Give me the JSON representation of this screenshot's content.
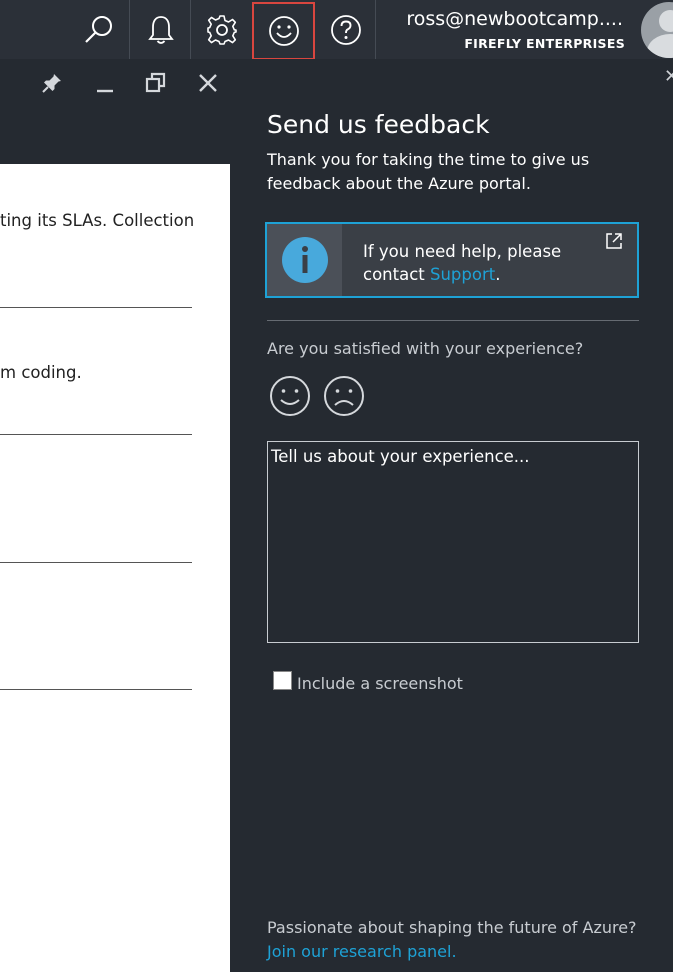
{
  "topbar": {
    "icons": [
      "search-icon",
      "bell-icon",
      "gear-icon",
      "smiley-icon",
      "help-icon"
    ],
    "active_icon": "smiley-icon",
    "user_name": "ross@newbootcamp....",
    "user_org": "FIREFLY ENTERPRISES"
  },
  "blade": {
    "controls": [
      "pin-icon",
      "minimize-icon",
      "restore-icon",
      "close-icon"
    ],
    "lines": [
      "ting its SLAs. Collection",
      "m coding."
    ]
  },
  "feedback": {
    "title": "Send us feedback",
    "subtitle": "Thank you for taking the time to give us feedback about the Azure portal.",
    "help_text": "If you need help, please contact ",
    "help_link": "Support",
    "help_period": ".",
    "question": "Are you satisfied with your experience?",
    "textarea_placeholder": "Tell us about your experience...",
    "screenshot_label": "Include a screenshot",
    "screenshot_checked": false,
    "footer_text": "Passionate about shaping the future of Azure?",
    "footer_link": "Join our research panel."
  },
  "colors": {
    "accent": "#1ea2d6",
    "active_border": "#d9463f",
    "panel_bg": "#252a31"
  }
}
